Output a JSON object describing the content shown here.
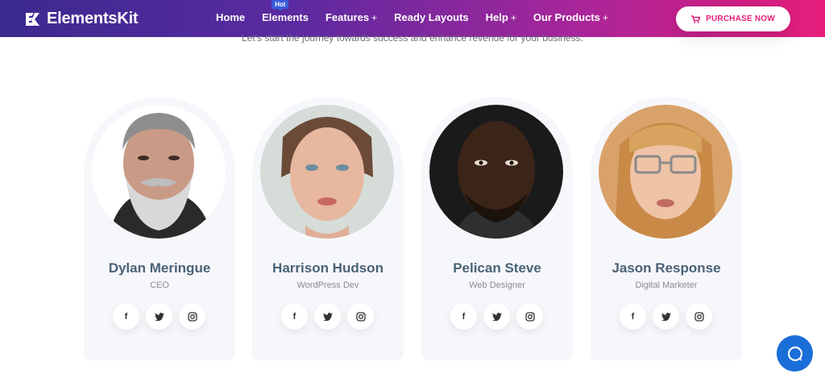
{
  "brand": {
    "name": "ElementsKit"
  },
  "nav": {
    "items": [
      {
        "label": "Home",
        "plus": ""
      },
      {
        "label": "Elements",
        "plus": "",
        "badge": "Hot"
      },
      {
        "label": "Features",
        "plus": "+"
      },
      {
        "label": "Ready Layouts",
        "plus": ""
      },
      {
        "label": "Help",
        "plus": "+"
      },
      {
        "label": "Our Products",
        "plus": "+"
      }
    ],
    "purchase_label": "PURCHASE NOW"
  },
  "subtitle": "Let's start the journey towards success and enhance revenue for your business.",
  "team": [
    {
      "name": "Dylan Meringue",
      "role": "CEO"
    },
    {
      "name": "Harrison Hudson",
      "role": "WordPress Dev"
    },
    {
      "name": "Pelican Steve",
      "role": "Web Designer"
    },
    {
      "name": "Jason Response",
      "role": "Digital Marketer"
    }
  ],
  "social_icons": [
    "facebook-icon",
    "twitter-icon",
    "instagram-icon"
  ],
  "colors": {
    "brand_pink": "#e61d7a",
    "brand_purple": "#3b2a8e",
    "card_bg": "#f6f7fb",
    "name_color": "#4a6275",
    "chat_blue": "#1a6ed8"
  }
}
